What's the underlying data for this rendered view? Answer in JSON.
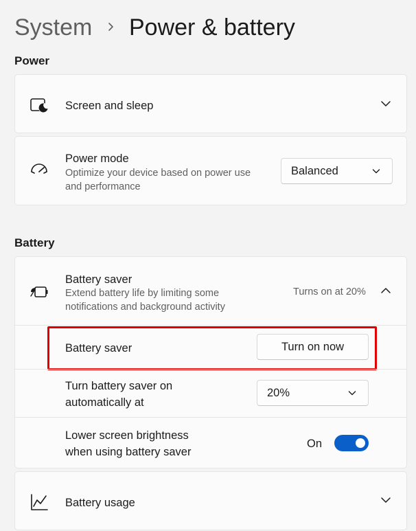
{
  "breadcrumb": {
    "parent": "System",
    "current": "Power & battery"
  },
  "colors": {
    "accent": "#0a60c8",
    "highlight": "#e00000",
    "background": "#f3f3f3",
    "card": "#fbfbfb"
  },
  "power": {
    "heading": "Power",
    "screen_sleep": {
      "label": "Screen and sleep",
      "icon": "screen-sleep-icon",
      "expand_icon": "chevron-down-icon"
    },
    "power_mode": {
      "label": "Power mode",
      "description_line1": "Optimize your device based on power use",
      "description_line2": "and performance",
      "icon": "gauge-icon",
      "selected": "Balanced"
    }
  },
  "battery": {
    "heading": "Battery",
    "saver": {
      "label": "Battery saver",
      "description_line1": "Extend battery life by limiting some",
      "description_line2": "notifications and background activity",
      "status": "Turns on at 20%",
      "icon": "battery-saver-icon",
      "collapse_icon": "chevron-up-icon",
      "turn_on_row": {
        "label": "Battery saver",
        "button": "Turn on now"
      },
      "auto_row": {
        "label_line1": "Turn battery saver on",
        "label_line2": "automatically at",
        "selected": "20%"
      },
      "brightness_row": {
        "label_line1": "Lower screen brightness",
        "label_line2": "when using battery saver",
        "state": "On",
        "toggle_on": true
      }
    },
    "usage": {
      "label": "Battery usage",
      "icon": "line-chart-icon",
      "expand_icon": "chevron-down-icon"
    }
  }
}
